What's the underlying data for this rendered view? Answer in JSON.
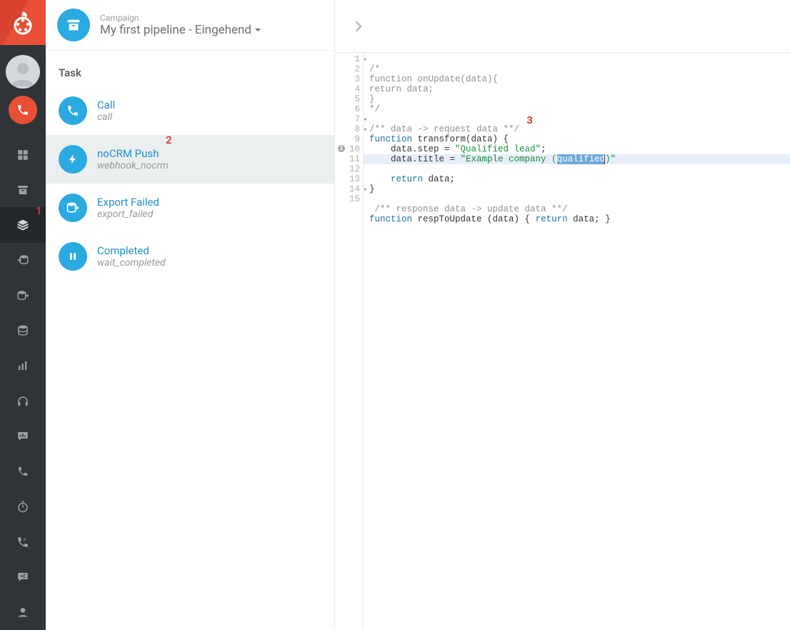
{
  "header": {
    "sublabel": "Campaign",
    "title": "My first pipeline - Eingehend"
  },
  "section": {
    "title": "Task"
  },
  "tasks": [
    {
      "title": "Call",
      "subtitle": "call",
      "icon": "phone"
    },
    {
      "title": "noCRM Push",
      "subtitle": "webhook_nocrm",
      "icon": "bolt"
    },
    {
      "title": "Export Failed",
      "subtitle": "export_failed",
      "icon": "db-arrow"
    },
    {
      "title": "Completed",
      "subtitle": "wait_completed",
      "icon": "pause"
    }
  ],
  "selected_task_index": 1,
  "code": {
    "line_count": 15,
    "fold_lines": [
      1,
      7,
      8,
      14
    ],
    "info_line": 10,
    "highlight_line": 10,
    "l1": "/*",
    "l2_kw": "function",
    "l2_rest": " onUpdate(data){",
    "l3_kw": "return",
    "l3_rest": " data;",
    "l4": "}",
    "l5": "*/",
    "l7": "/** data -> request data **/",
    "l8_kw": "function",
    "l8_fn": " transform",
    "l8_rest": "(data) {",
    "l9_a": "    data.step = ",
    "l9_str": "\"Qualified lead\"",
    "l9_b": ";",
    "l10_a": "    data.title = ",
    "l10_str_a": "\"Example company (",
    "l10_sel": "qualified",
    "l10_str_b": ")\"",
    "l11_a": "    ",
    "l11_kw": "return",
    "l11_b": " data;",
    "l12": "}",
    "l14_a": " ",
    "l14_c": "/** response data -> update data **/",
    "l15_kw1": "function",
    "l15_fn": " respToUpdate ",
    "l15_a": "(data) { ",
    "l15_kw2": "return",
    "l15_b": " data; }"
  },
  "annotations": {
    "a1": "1",
    "a2": "2",
    "a3": "3"
  }
}
